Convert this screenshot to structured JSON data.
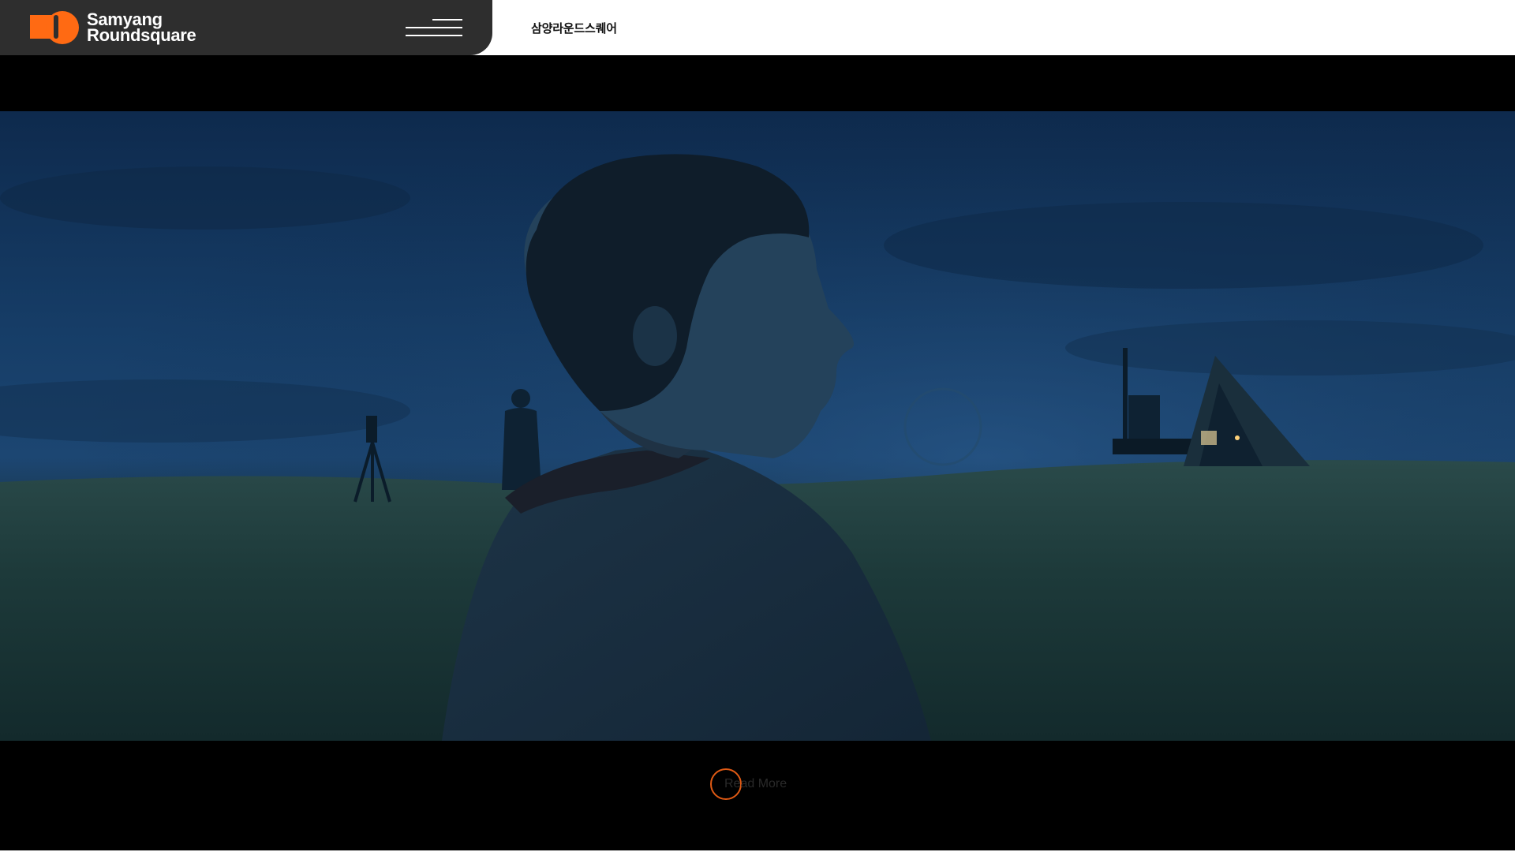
{
  "header": {
    "logo": {
      "line1": "Samyang",
      "line2": "Roundsquare"
    },
    "menu_icon": "hamburger-menu-icon",
    "brand_korean": "삼양라운드스퀘어"
  },
  "hero": {
    "media": "video-still-night-field"
  },
  "cta": {
    "read_more_label": "Read More"
  },
  "colors": {
    "brand_orange": "#ff6a13",
    "header_dark": "#2e2e2e",
    "header_light": "#ffffff",
    "background": "#000000"
  }
}
